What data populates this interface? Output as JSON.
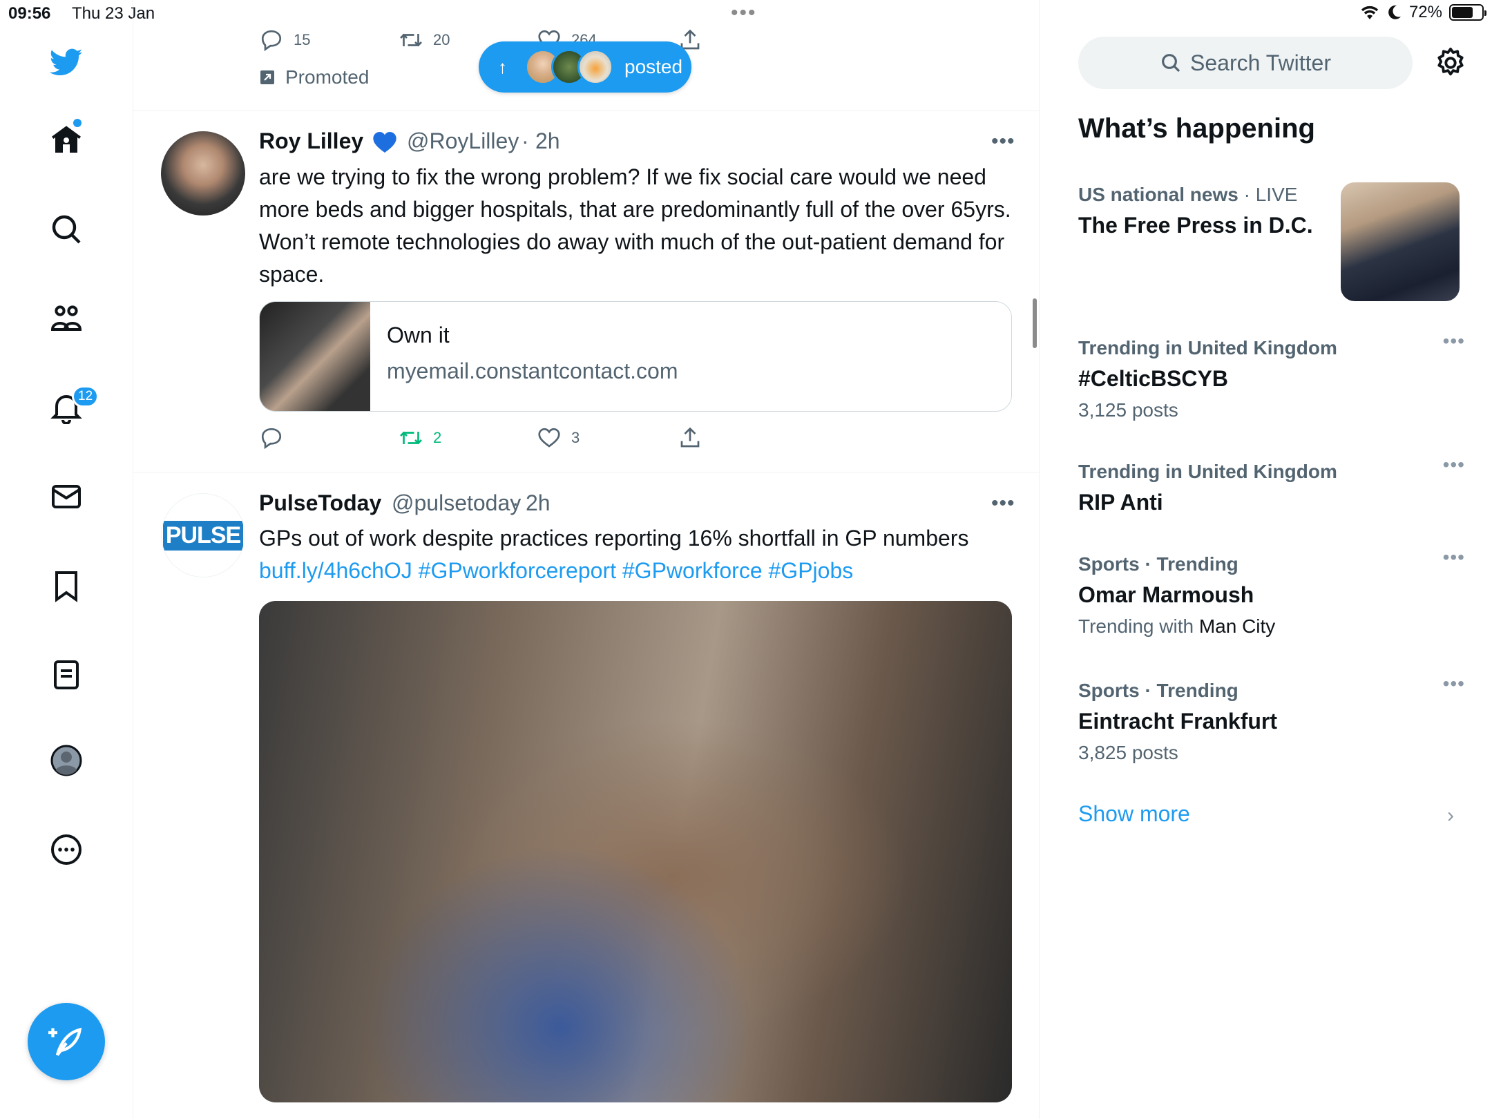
{
  "status_bar": {
    "time": "09:56",
    "date": "Thu 23 Jan",
    "dots": "•••",
    "battery": "72%"
  },
  "nav": {
    "notifications_badge": "12"
  },
  "top_tweet": {
    "reply_count": "15",
    "retweet_count": "20",
    "like_count": "264",
    "promoted_label": "Promoted"
  },
  "posted_pill": {
    "label": "posted"
  },
  "tweet1": {
    "name": "Roy Lilley",
    "handle": "@RoyLilley",
    "time": "2h",
    "dots": "•••",
    "text": "are we trying to fix the wrong problem? If we fix social care would we need more beds and bigger hospitals, that are predominantly full of the over 65yrs. Won’t remote technologies do away with much of the out-patient demand for space.",
    "card": {
      "title": "Own it",
      "domain": "myemail.constantcontact.com"
    },
    "retweet_count": "2",
    "like_count": "3"
  },
  "tweet2": {
    "name": "PulseToday",
    "handle": "@pulsetoday",
    "time": "2h",
    "dots": "•••",
    "avatar_text": "PULSE",
    "text_plain": "GPs out of work despite practices reporting 16% shortfall in GP numbers ",
    "link": "buff.ly/4h6chOJ",
    "hashtags": "#GPworkforcereport #GPworkforce #GPjobs"
  },
  "sidebar": {
    "search_placeholder": "Search Twitter",
    "title": "What’s happening",
    "news": {
      "category": "US national news",
      "live": "LIVE",
      "title": "The Free Press in D.C."
    },
    "trends": [
      {
        "meta": "Trending in United Kingdom",
        "title": "#CelticBSCYB",
        "sub": "3,125 posts"
      },
      {
        "meta": "Trending in United Kingdom",
        "title": "RIP Anti",
        "sub": ""
      },
      {
        "meta": "Sports · Trending",
        "title": "Omar Marmoush",
        "sub_prefix": "Trending with ",
        "sub_strong": "Man City"
      },
      {
        "meta": "Sports · Trending",
        "title": "Eintracht Frankfurt",
        "sub": "3,825 posts"
      }
    ],
    "trend_dots": "•••",
    "show_more": "Show more",
    "chevron": "›"
  },
  "colors": {
    "accent": "#1d9bf0",
    "retweet_green": "#00ba7c",
    "secondary_text": "#536471",
    "divider": "#eff3f4"
  },
  "icons": [
    "twitter-logo-icon",
    "home-icon",
    "search-icon",
    "communities-icon",
    "bell-icon",
    "mail-icon",
    "bookmark-icon",
    "lists-icon",
    "profile-icon",
    "more-icon",
    "compose-icon",
    "reply-icon",
    "retweet-icon",
    "like-icon",
    "share-icon",
    "promoted-icon",
    "gear-icon",
    "wifi-icon",
    "moon-icon",
    "battery-icon",
    "verified-heart-icon"
  ]
}
